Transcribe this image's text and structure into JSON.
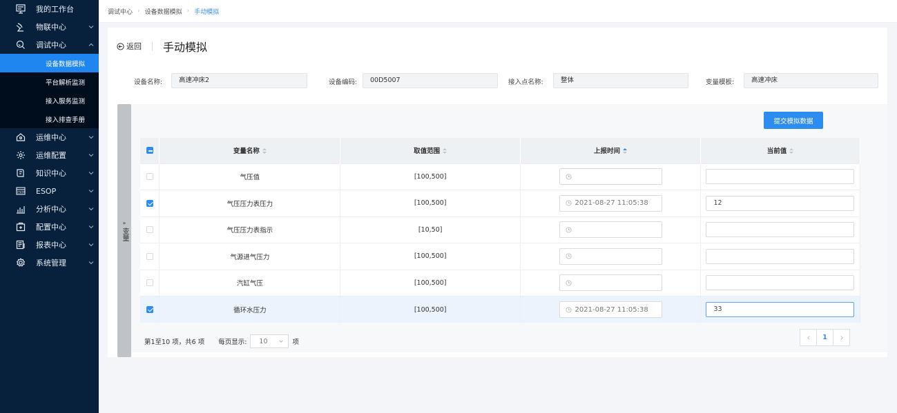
{
  "sidebar": {
    "items": [
      {
        "label": "我的工作台",
        "icon": "monitor-icon"
      },
      {
        "label": "物联中心",
        "icon": "antenna-icon",
        "chevron": "down"
      },
      {
        "label": "调试中心",
        "icon": "debug-search-icon",
        "chevron": "up"
      },
      {
        "label": "运维中心",
        "icon": "house-icon",
        "chevron": "down"
      },
      {
        "label": "运维配置",
        "icon": "gear-icon",
        "chevron": "down"
      },
      {
        "label": "知识中心",
        "icon": "book-icon",
        "chevron": "down"
      },
      {
        "label": "ESOP",
        "icon": "esop-icon",
        "chevron": "down"
      },
      {
        "label": "分析中心",
        "icon": "bar-chart-icon",
        "chevron": "down"
      },
      {
        "label": "配置中心",
        "icon": "config-box-icon",
        "chevron": "down"
      },
      {
        "label": "报表中心",
        "icon": "report-icon",
        "chevron": "down"
      },
      {
        "label": "系统管理",
        "icon": "settings-icon",
        "chevron": "down"
      }
    ],
    "sub_items": [
      "设备数据模拟",
      "平台解析监测",
      "接入服务监测",
      "接入排查手册"
    ],
    "active_sub": "设备数据模拟"
  },
  "breadcrumb": [
    "调试中心",
    "设备数据模拟",
    "手动模拟"
  ],
  "header": {
    "back_label": "返回",
    "title": "手动模拟"
  },
  "fields": [
    {
      "label": "设备名称:",
      "value": "高速冲床2"
    },
    {
      "label": "设备编码:",
      "value": "00D5007"
    },
    {
      "label": "接入点名称:",
      "value": "整体"
    },
    {
      "label": "变量模板:",
      "value": "高速冲床"
    }
  ],
  "variable_panel_label": "变量",
  "submit_label": "提交模拟数据",
  "table": {
    "columns": [
      "变量名称",
      "取值范围",
      "上报时间",
      "当前值"
    ],
    "rows": [
      {
        "name": "气压值",
        "range": "[100,500]",
        "time": "",
        "value": "",
        "checked": false
      },
      {
        "name": "气压压力表压力",
        "range": "[100,500]",
        "time": "2021-08-27 11:05:38",
        "value": "12",
        "checked": true
      },
      {
        "name": "气压压力表指示",
        "range": "[10,50]",
        "time": "",
        "value": "",
        "checked": false
      },
      {
        "name": "气源进气压力",
        "range": "[100,500]",
        "time": "",
        "value": "",
        "checked": false
      },
      {
        "name": "汽缸气压",
        "range": "[100,500]",
        "time": "",
        "value": "",
        "checked": false
      },
      {
        "name": "循环水压力",
        "range": "[100,500]",
        "time": "2021-08-27 11:05:38",
        "value": "33",
        "checked": true
      }
    ]
  },
  "footer": {
    "summary": "第1至10 项，共6 项",
    "per_page_label": "每页显示:",
    "per_page_value": "10",
    "per_page_unit": "项",
    "current_page": "1"
  },
  "colors": {
    "sidebar_bg": "#07203b",
    "accent": "#2d8cf0",
    "active_sub_bg": "#1f86f0"
  }
}
